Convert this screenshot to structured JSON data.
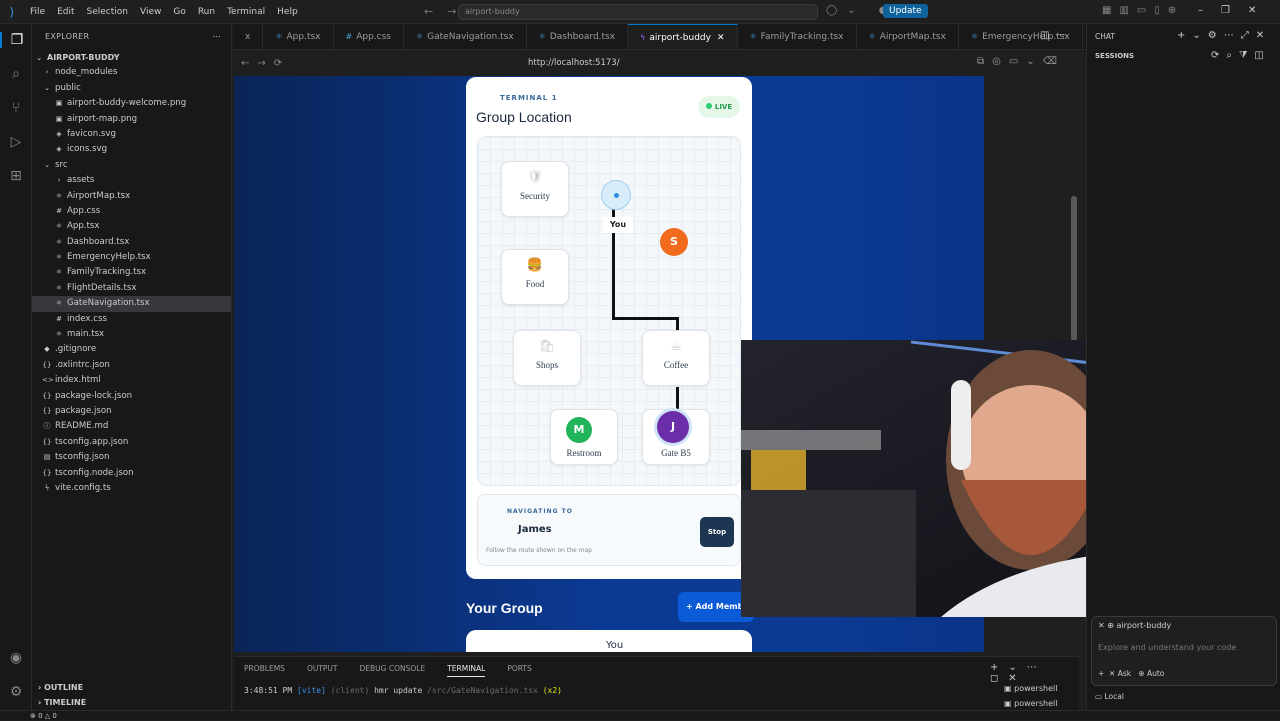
{
  "menu": [
    "File",
    "Edit",
    "Selection",
    "View",
    "Go",
    "Run",
    "Terminal",
    "Help"
  ],
  "command_center": "airport-buddy",
  "update_label": "Update",
  "explorer": {
    "title": "EXPLORER",
    "root": "AIRPORT-BUDDY",
    "items": [
      {
        "label": "node_modules",
        "depth": 1,
        "icon": "›"
      },
      {
        "label": "public",
        "depth": 1,
        "icon": "⌄"
      },
      {
        "label": "airport-buddy-welcome.png",
        "depth": 2,
        "icon": "▣"
      },
      {
        "label": "airport-map.png",
        "depth": 2,
        "icon": "▣"
      },
      {
        "label": "favicon.svg",
        "depth": 2,
        "icon": "◈"
      },
      {
        "label": "icons.svg",
        "depth": 2,
        "icon": "◈"
      },
      {
        "label": "src",
        "depth": 1,
        "icon": "⌄"
      },
      {
        "label": "assets",
        "depth": 2,
        "icon": "›"
      },
      {
        "label": "AirportMap.tsx",
        "depth": 2,
        "icon": "⚛"
      },
      {
        "label": "App.css",
        "depth": 2,
        "icon": "#"
      },
      {
        "label": "App.tsx",
        "depth": 2,
        "icon": "⚛"
      },
      {
        "label": "Dashboard.tsx",
        "depth": 2,
        "icon": "⚛"
      },
      {
        "label": "EmergencyHelp.tsx",
        "depth": 2,
        "icon": "⚛"
      },
      {
        "label": "FamilyTracking.tsx",
        "depth": 2,
        "icon": "⚛"
      },
      {
        "label": "FlightDetails.tsx",
        "depth": 2,
        "icon": "⚛"
      },
      {
        "label": "GateNavigation.tsx",
        "depth": 2,
        "icon": "⚛",
        "selected": true
      },
      {
        "label": "index.css",
        "depth": 2,
        "icon": "#"
      },
      {
        "label": "main.tsx",
        "depth": 2,
        "icon": "⚛"
      },
      {
        "label": ".gitignore",
        "depth": 1,
        "icon": "◆"
      },
      {
        "label": ".oxlintrc.json",
        "depth": 1,
        "icon": "{}"
      },
      {
        "label": "index.html",
        "depth": 1,
        "icon": "<>"
      },
      {
        "label": "package-lock.json",
        "depth": 1,
        "icon": "{}"
      },
      {
        "label": "package.json",
        "depth": 1,
        "icon": "{}"
      },
      {
        "label": "README.md",
        "depth": 1,
        "icon": "ⓘ"
      },
      {
        "label": "tsconfig.app.json",
        "depth": 1,
        "icon": "{}"
      },
      {
        "label": "tsconfig.json",
        "depth": 1,
        "icon": "▤"
      },
      {
        "label": "tsconfig.node.json",
        "depth": 1,
        "icon": "{}"
      },
      {
        "label": "vite.config.ts",
        "depth": 1,
        "icon": "ϟ"
      }
    ],
    "outline": "OUTLINE",
    "timeline": "TIMELINE"
  },
  "tabs": [
    {
      "label": "x",
      "icon": ""
    },
    {
      "label": "App.tsx",
      "icon": "⚛"
    },
    {
      "label": "App.css",
      "icon": "#"
    },
    {
      "label": "GateNavigation.tsx",
      "icon": "⚛"
    },
    {
      "label": "Dashboard.tsx",
      "icon": "⚛"
    },
    {
      "label": "airport-buddy",
      "icon": "ϟ",
      "active": true
    },
    {
      "label": "FamilyTracking.tsx",
      "icon": "⚛"
    },
    {
      "label": "AirportMap.tsx",
      "icon": "⚛"
    },
    {
      "label": "EmergencyHelp.tsx",
      "icon": "⚛"
    }
  ],
  "browser": {
    "url": "http://localhost:5173/"
  },
  "app": {
    "terminal_label": "TERMINAL 1",
    "title": "Group Location",
    "live": "LIVE",
    "pois": {
      "security": {
        "label": "Security",
        "icon": "🛡"
      },
      "food": {
        "label": "Food",
        "icon": "🍔"
      },
      "shops": {
        "label": "Shops",
        "icon": "🛍"
      },
      "coffee": {
        "label": "Coffee",
        "icon": "☕"
      },
      "restroom": {
        "label": "Restroom",
        "icon": ""
      },
      "gate": {
        "label": "Gate B5",
        "icon": ""
      }
    },
    "you_label": "You",
    "avatars": {
      "s": {
        "letter": "S",
        "color": "#f26b1d"
      },
      "m": {
        "letter": "M",
        "color": "#22b45a"
      },
      "j": {
        "letter": "J",
        "color": "#6b2ea8"
      }
    },
    "navigating_to_label": "NAVIGATING TO",
    "navigating_to_name": "James",
    "navigating_hint": "Follow the route shown on the map",
    "stop_label": "Stop",
    "your_group": "Your Group",
    "add_member": "+ Add Member",
    "member_first": "You"
  },
  "panel": {
    "tabs": [
      "PROBLEMS",
      "OUTPUT",
      "DEBUG CONSOLE",
      "TERMINAL",
      "PORTS"
    ],
    "active_tab": "TERMINAL",
    "log": {
      "time": "3:48:51 PM",
      "tag": "[vite]",
      "client": "(client)",
      "msg": "hmr update",
      "path": "/src/GateNavigation.tsx",
      "count": "(x2)"
    },
    "shells": [
      "powershell",
      "powershell"
    ]
  },
  "chat": {
    "title": "CHAT",
    "sessions": "SESSIONS",
    "context_chip": "airport-buddy",
    "placeholder": "Explore and understand your code",
    "mode_ask": "Ask",
    "mode_auto": "Auto",
    "local": "Local"
  },
  "status": {
    "errors": "0",
    "warnings": "0"
  }
}
